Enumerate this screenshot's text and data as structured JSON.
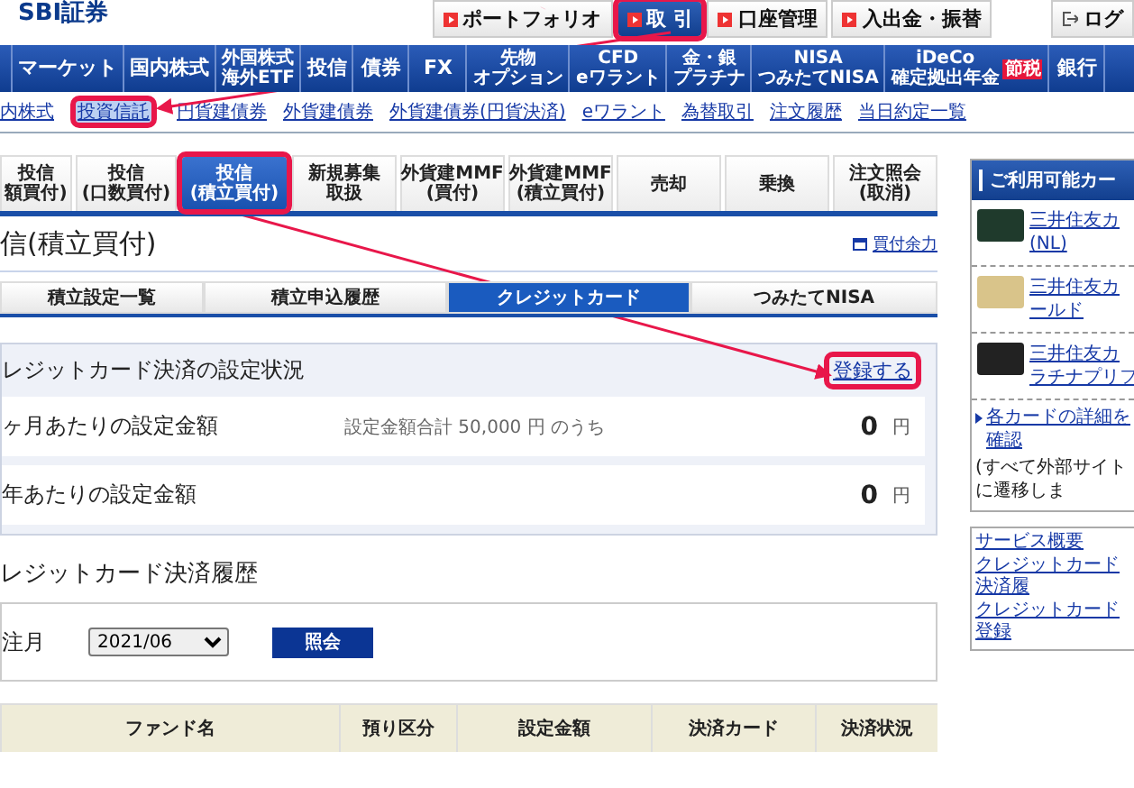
{
  "header": {
    "logo": "SBI証券",
    "buttons": [
      {
        "label": "ポートフォリオ",
        "kind": "link",
        "selected": false,
        "highlighted": false
      },
      {
        "label": "取 引",
        "kind": "link",
        "selected": true,
        "highlighted": true
      },
      {
        "label": "口座管理",
        "kind": "link",
        "selected": false,
        "highlighted": false
      },
      {
        "label": "入出金・振替",
        "kind": "link",
        "selected": false,
        "highlighted": false
      },
      {
        "label": "ログ",
        "kind": "logout",
        "selected": false,
        "highlighted": false
      }
    ]
  },
  "main_nav": [
    {
      "lines": [
        "マーケット"
      ]
    },
    {
      "lines": [
        "国内株式"
      ]
    },
    {
      "lines": [
        "外国株式",
        "海外ETF"
      ]
    },
    {
      "lines": [
        "投信"
      ]
    },
    {
      "lines": [
        "債券"
      ]
    },
    {
      "lines": [
        "FX"
      ]
    },
    {
      "lines": [
        "先物",
        "オプション"
      ]
    },
    {
      "lines": [
        "CFD",
        "eワラント"
      ]
    },
    {
      "lines": [
        "金・銀",
        "プラチナ"
      ]
    },
    {
      "lines": [
        "NISA",
        "つみたてNISA"
      ]
    },
    {
      "lines": [
        "iDeCo",
        "確定拠出年金"
      ],
      "badge": "節税"
    },
    {
      "lines": [
        "銀行"
      ]
    }
  ],
  "sub_nav": [
    {
      "label": "内株式",
      "selected": false
    },
    {
      "label": "投資信託",
      "selected": true
    },
    {
      "label": "円貨建債券",
      "selected": false
    },
    {
      "label": "外貨建債券",
      "selected": false
    },
    {
      "label": "外貨建債券(円貨決済)",
      "selected": false
    },
    {
      "label": "eワラント",
      "selected": false
    },
    {
      "label": "為替取引",
      "selected": false
    },
    {
      "label": "注文履歴",
      "selected": false
    },
    {
      "label": "当日約定一覧",
      "selected": false
    }
  ],
  "trade_tabs": [
    {
      "lines": [
        "投信",
        "額買付)"
      ],
      "selected": false
    },
    {
      "lines": [
        "投信",
        "(口数買付)"
      ],
      "selected": false
    },
    {
      "lines": [
        "投信",
        "(積立買付)"
      ],
      "selected": true
    },
    {
      "lines": [
        "新規募集",
        "取扱"
      ],
      "selected": false
    },
    {
      "lines": [
        "外貨建MMF",
        "(買付)"
      ],
      "selected": false
    },
    {
      "lines": [
        "外貨建MMF",
        "(積立買付)"
      ],
      "selected": false
    },
    {
      "lines": [
        "売却"
      ],
      "selected": false
    },
    {
      "lines": [
        "乗換"
      ],
      "selected": false
    },
    {
      "lines": [
        "注文照会",
        "(取消)"
      ],
      "selected": false
    }
  ],
  "page_title": "信(積立買付)",
  "buying_power_link": "買付余力",
  "sub_tabs": [
    {
      "label": "積立設定一覧",
      "selected": false
    },
    {
      "label": "積立申込履歴",
      "selected": false
    },
    {
      "label": "クレジットカード",
      "selected": true
    },
    {
      "label": "つみたてNISA",
      "selected": false
    }
  ],
  "settings_panel": {
    "title": "レジットカード決済の設定状況",
    "register_link": "登録する",
    "rows": [
      {
        "label": "ヶ月あたりの設定金額",
        "note": "設定金額合計 50,000 円 のうち",
        "amount": "0",
        "unit": "円"
      },
      {
        "label": "年あたりの設定金額",
        "amount": "0",
        "unit": "円"
      }
    ]
  },
  "history": {
    "title": "レジットカード決済履歴",
    "filter_label": "注月",
    "month_select": "2021/06",
    "query_button": "照会",
    "columns": [
      "ファンド名",
      "預り区分",
      "設定金額",
      "決済カード",
      "決済状況"
    ]
  },
  "sidebar": {
    "title": "ご利用可能カー",
    "cards": [
      {
        "lines": [
          "三井住友カ",
          "(NL)"
        ],
        "color": "#1f3a2c"
      },
      {
        "lines": [
          "三井住友カ",
          "ールド"
        ],
        "color": "#d9c48a"
      },
      {
        "lines": [
          "三井住友カ",
          "ラチナプリフ"
        ],
        "color": "#222222"
      }
    ],
    "details_link": "各カードの詳細を確認",
    "note": "(すべて外部サイトに遷移しま",
    "service": {
      "title": "サービス概要",
      "links": [
        "クレジットカード決済履",
        "クレジットカード登録"
      ]
    }
  }
}
